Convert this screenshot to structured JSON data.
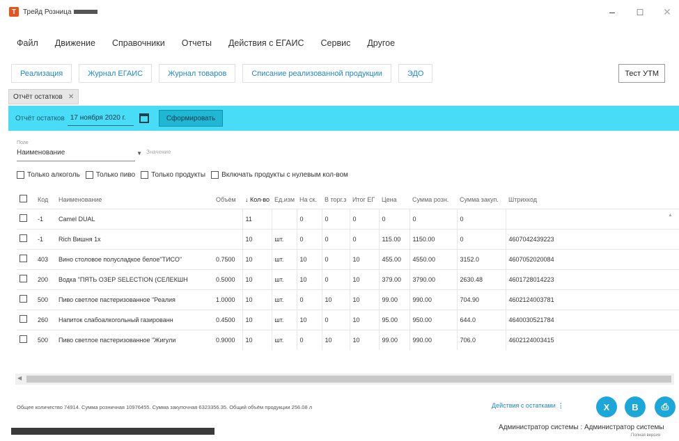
{
  "window": {
    "title": "Трейд Розница",
    "controls": [
      "–",
      "□",
      "✕"
    ]
  },
  "menu": [
    "Файл",
    "Движение",
    "Справочники",
    "Отчеты",
    "Действия с ЕГАИС",
    "Сервис",
    "Другое"
  ],
  "quick_tabs": [
    "Реализация",
    "Журнал ЕГАИС",
    "Журнал товаров",
    "Списание реализованной продукции",
    "ЭДО"
  ],
  "test_button": "Тест УТМ",
  "doc_tab": "Отчёт остатков",
  "toolbar": {
    "label": "Отчёт остатков",
    "date": "17 ноября 2020 г.",
    "generate_button": "Сформировать"
  },
  "filter": {
    "caption": "Поле",
    "field_value": "Наименование",
    "value_placeholder": "Значение"
  },
  "checkboxes": [
    "Только алкоголь",
    "Только пиво",
    "Только продукты",
    "Включать продукты с нулевым кол-вом"
  ],
  "table": {
    "columns": [
      "Код",
      "Наименование",
      "Объём",
      "Кол-во",
      "Ед.изм",
      "На ск.",
      "В торг.з",
      "Итог ЕГ",
      "Цена",
      "Сумма розн.",
      "Сумма закуп.",
      "Штрихкод"
    ],
    "sorted_column": "Кол-во",
    "sort_arrow": "↓",
    "rows": [
      [
        "-1",
        "Camel DUAL",
        "",
        "11",
        "",
        "0",
        "0",
        "0",
        "0",
        "0",
        "0",
        ""
      ],
      [
        "-1",
        "Rich Вишня 1х",
        "",
        "10",
        "шт.",
        "0",
        "0",
        "0",
        "115.00",
        "1150.00",
        "0",
        "4607042439223"
      ],
      [
        "403",
        "Вино столовое полусладкое белое\"ТИСО\"",
        "0.7500",
        "10",
        "шт.",
        "10",
        "0",
        "10",
        "455.00",
        "4550.00",
        "3152.0",
        "4607052020084"
      ],
      [
        "200",
        "Водка \"ПЯТЬ ОЗЕР SELECTION (СЕЛЕКШН",
        "0.5000",
        "10",
        "шт.",
        "10",
        "0",
        "10",
        "379.00",
        "3790.00",
        "2630.48",
        "4601728014223"
      ],
      [
        "500",
        "Пиво светлое пастеризованное \"Реалия",
        "1.0000",
        "10",
        "шт.",
        "0",
        "10",
        "10",
        "99.00",
        "990.00",
        "704.90",
        "4602124003781"
      ],
      [
        "260",
        "Напиток слабоалкогольный газированн",
        "0.4500",
        "10",
        "шт.",
        "10",
        "0",
        "10",
        "95.00",
        "950.00",
        "644.0",
        "4640030521784"
      ],
      [
        "500",
        "Пиво светлое пастеризованное \"Жигули",
        "0.9000",
        "10",
        "шт.",
        "0",
        "10",
        "10",
        "99.00",
        "990.00",
        "706.0",
        "4602124003415"
      ]
    ]
  },
  "status": {
    "totals": "Общее количество 74914. Сумма розничная 10976455. Сумма закупочная 6323356.35. Общий объём продукции 256.08 л",
    "actions_link": "Действия с остатками",
    "actions_dots": "⋮",
    "user": "Администратор системы : Администратор системы",
    "sub_user": "Полная версия"
  },
  "action_buttons": [
    {
      "name": "excel-export-icon",
      "glyph": "X"
    },
    {
      "name": "document-icon",
      "glyph": "B"
    },
    {
      "name": "print-icon",
      "glyph": "⎙"
    }
  ]
}
